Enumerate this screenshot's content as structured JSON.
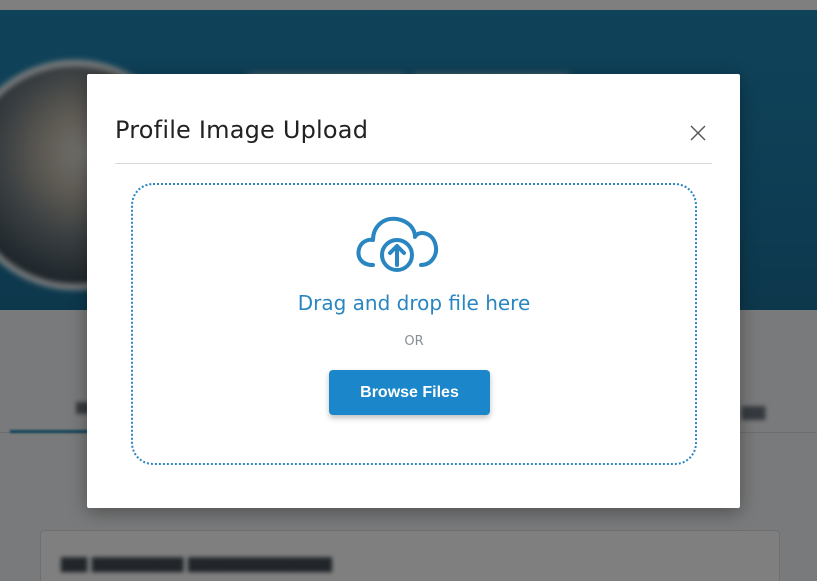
{
  "modal": {
    "title": "Profile Image Upload",
    "close_icon": "close-icon",
    "dropzone": {
      "icon": "cloud-upload-icon",
      "drop_label": "Drag and drop file here",
      "or_label": "OR",
      "browse_label": "Browse Files"
    }
  },
  "colors": {
    "accent": "#2a86c1",
    "button": "#1b86c9",
    "banner": "#1f86b4"
  }
}
